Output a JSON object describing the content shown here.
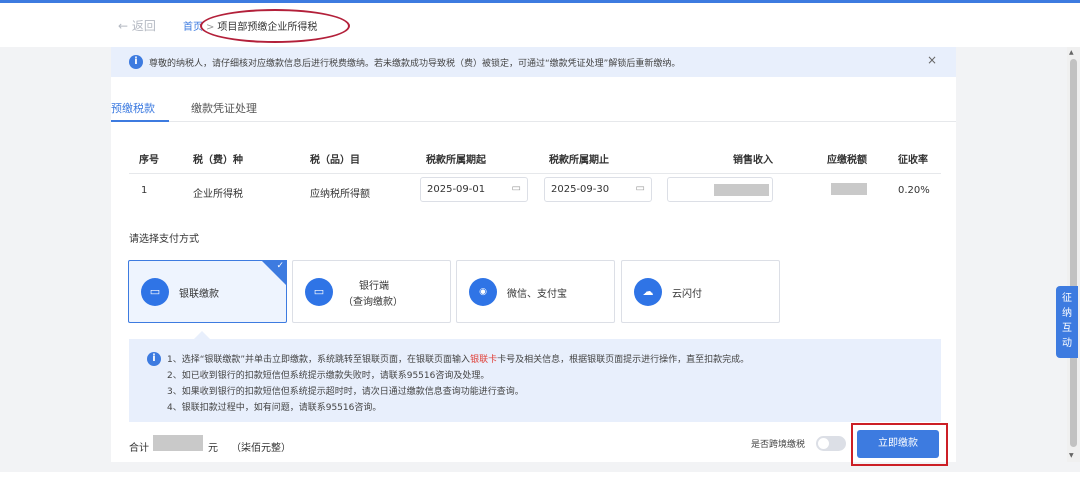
{
  "header": {
    "back_label": "← 返回",
    "breadcrumb_home": "首页",
    "breadcrumb_sep": ">",
    "breadcrumb_current": "项目部预缴企业所得税"
  },
  "notice": {
    "icon": "info-icon",
    "text": "尊敬的纳税人，请仔细核对应缴款信息后进行税费缴纳。若未缴款成功导致税（费）被锁定，可通过“缴款凭证处理”解锁后重新缴纳。",
    "close": "×"
  },
  "tabs": [
    {
      "label": "预缴税款",
      "active": true
    },
    {
      "label": "缴款凭证处理",
      "active": false
    }
  ],
  "table": {
    "headers": [
      "序号",
      "税（费）种",
      "税（品）目",
      "税款所属期起",
      "税款所属期止",
      "销售收入",
      "应缴税额",
      "征收率"
    ],
    "row": {
      "index": "1",
      "tax_type": "企业所得税",
      "tax_item": "应纳税所得额",
      "period_start": "2025-09-01",
      "period_end": "2025-09-30",
      "rate": "0.20%"
    }
  },
  "payment": {
    "title": "请选择支付方式",
    "methods": [
      {
        "label": "银联缴款",
        "icon": "unionpay-card-icon",
        "selected": true
      },
      {
        "label_line1": "银行端",
        "label_line2": "（查询缴款）",
        "icon": "bank-icon",
        "selected": false
      },
      {
        "label": "微信、支付宝",
        "icon": "wechat-alipay-icon",
        "selected": false
      },
      {
        "label": "云闪付",
        "icon": "cloud-quickpass-icon",
        "selected": false
      }
    ]
  },
  "guide": {
    "line1_pre": "1、选择“银联缴款”并单击立即缴款，系统跳转至银联页面，在银联页面输入",
    "line1_red": "银联卡",
    "line1_post": "卡号及相关信息，根据银联页面提示进行操作，直至扣款完成。",
    "line2": "2、如已收到银行的扣款短信但系统提示缴款失败时，请联系95516咨询及处理。",
    "line3": "3、如果收到银行的扣款短信但系统提示超时时，请次日通过缴款信息查询功能进行查询。",
    "line4": "4、银联扣款过程中，如有问题，请联系95516咨询。"
  },
  "footer": {
    "total_label": "合计",
    "total_unit": "元",
    "total_words": "（柒佰元整）",
    "cross_border_label": "是否跨境缴税",
    "cross_border_enabled": false,
    "pay_button": "立即缴款"
  },
  "side_tab": {
    "lines": [
      "征",
      "纳",
      "互",
      "动"
    ]
  },
  "colors": {
    "accent": "#3d7be0",
    "annotation_red": "#cc1f26",
    "highlight_red": "#e0413a"
  }
}
